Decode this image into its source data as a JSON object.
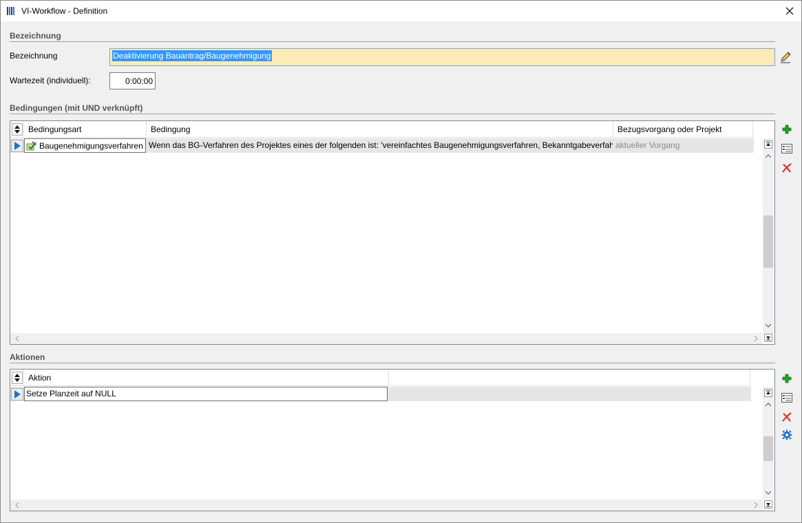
{
  "window": {
    "title": "VI-Workflow - Definition"
  },
  "sections": {
    "bezeichnung": "Bezeichnung",
    "bedingungen": "Bedingungen (mit UND verknüpft)",
    "aktionen": "Aktionen"
  },
  "fields": {
    "name_label": "Bezeichnung",
    "name_value": "Deaktivierung Bauantrag/Baugenehmigung",
    "wait_label": "Wartezeit (individuell):",
    "wait_value": "0:00:00"
  },
  "conditions_grid": {
    "columns": [
      "Bedingungsart",
      "Bedingung",
      "Bezugsvorgang oder Projekt"
    ],
    "rows": [
      {
        "type": "Baugenehmigungsverfahren",
        "condition": "Wenn das BG-Verfahren des Projektes eines der folgenden ist: 'vereinfachtes Baugenehmigungsverfahren, Bekanntgabeverfahre",
        "reference": "aktueller Vorgang"
      }
    ]
  },
  "actions_grid": {
    "columns": [
      "Aktion"
    ],
    "rows": [
      {
        "action": "Setze Planzeit auf NULL"
      }
    ]
  },
  "colors": {
    "input_highlight": "#fcebb6",
    "selection": "#3297fd",
    "add_icon": "#22a322",
    "delete_icon": "#d9302c",
    "settings_icon": "#1f74c8"
  }
}
